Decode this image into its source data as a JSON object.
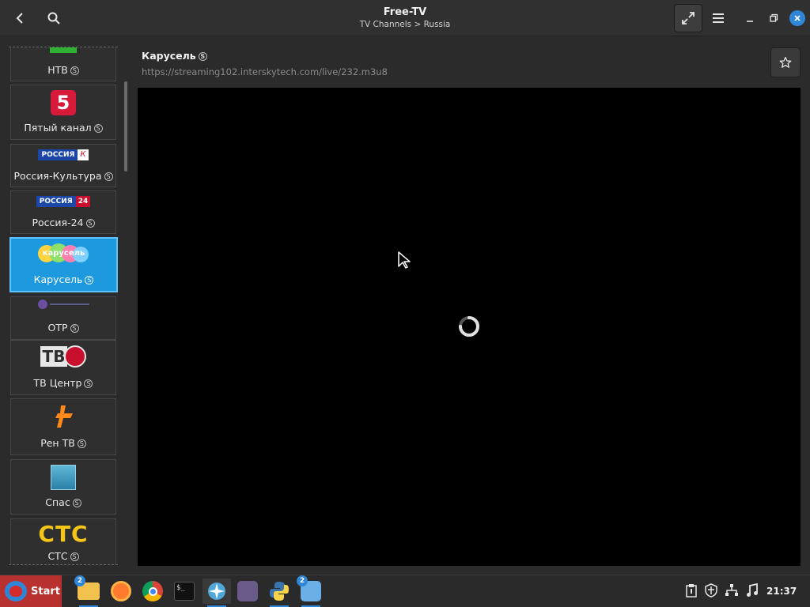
{
  "app": {
    "title": "Free-TV",
    "breadcrumb": "TV Channels > Russia"
  },
  "channels": [
    {
      "name": "НТВ"
    },
    {
      "name": "Пятый канал",
      "logo_text": "5"
    },
    {
      "name": "Россия-Культура",
      "logo_text": "РОССИЯ",
      "logo_badge": "К"
    },
    {
      "name": "Россия-24",
      "logo_text": "РОССИЯ",
      "logo_badge": "24"
    },
    {
      "name": "Карусель",
      "logo_text": "карусель",
      "selected": true
    },
    {
      "name": "ОТР"
    },
    {
      "name": "ТВ Центр",
      "logo_text": "ТВ"
    },
    {
      "name": "Рен ТВ"
    },
    {
      "name": "Спас"
    },
    {
      "name": "СТС",
      "logo_text": "СТС"
    }
  ],
  "stream_mark": "S",
  "player": {
    "channel_title": "Карусель",
    "url": "https://streaming102.interskytech.com/live/232.m3u8"
  },
  "taskbar": {
    "start_label": "Start",
    "files_badge": "2",
    "notes_badge": "2",
    "clock": "21:37"
  },
  "colors": {
    "accent": "#1d99e0",
    "start_button": "#b8312f",
    "badge": "#2f86d6"
  }
}
